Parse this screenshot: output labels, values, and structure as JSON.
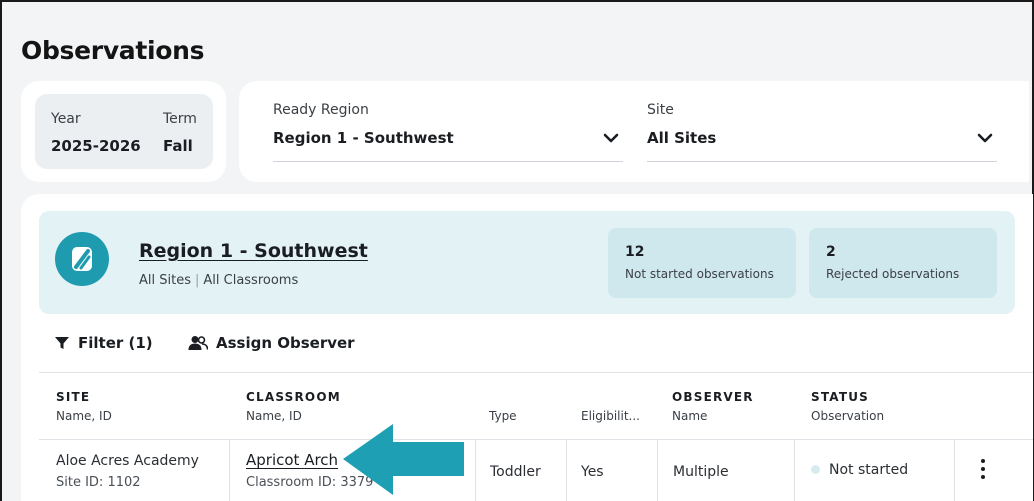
{
  "page": {
    "title": "Observations"
  },
  "year_term": {
    "year_label": "Year",
    "year_value": "2025-2026",
    "term_label": "Term",
    "term_value": "Fall"
  },
  "filters": {
    "region": {
      "label": "Ready Region",
      "value": "Region 1 - Southwest"
    },
    "site": {
      "label": "Site",
      "value": "All Sites"
    }
  },
  "banner": {
    "title": "Region 1 - Southwest",
    "sub_sites": "All Sites",
    "sub_separator": "|",
    "sub_classrooms": "All Classrooms",
    "stats": [
      {
        "count": "12",
        "label": "Not started observations"
      },
      {
        "count": "2",
        "label": "Rejected observations"
      }
    ]
  },
  "toolbar": {
    "filter_label": "Filter (1)",
    "assign_label": "Assign Observer"
  },
  "table": {
    "headers": [
      {
        "title": "SITE",
        "subtitle": "Name, ID"
      },
      {
        "title": "CLASSROOM",
        "subtitle": "Name, ID"
      },
      {
        "title": "",
        "subtitle": "Type"
      },
      {
        "title": "",
        "subtitle": "Eligibilit..."
      },
      {
        "title": "OBSERVER",
        "subtitle": "Name"
      },
      {
        "title": "STATUS",
        "subtitle": "Observation"
      }
    ],
    "rows": [
      {
        "site_name": "Aloe Acres Academy",
        "site_id": "Site ID: 1102",
        "classroom_name": "Apricot Arch",
        "classroom_id": "Classroom ID: 3379",
        "type": "Toddler",
        "eligibility": "Yes",
        "observer": "Multiple",
        "status": "Not started"
      }
    ]
  },
  "colors": {
    "accent": "#1f9bb0",
    "arrow": "#1e9fb3",
    "banner_bg": "#e3f2f4",
    "stat_bg": "#cfe8ed"
  }
}
